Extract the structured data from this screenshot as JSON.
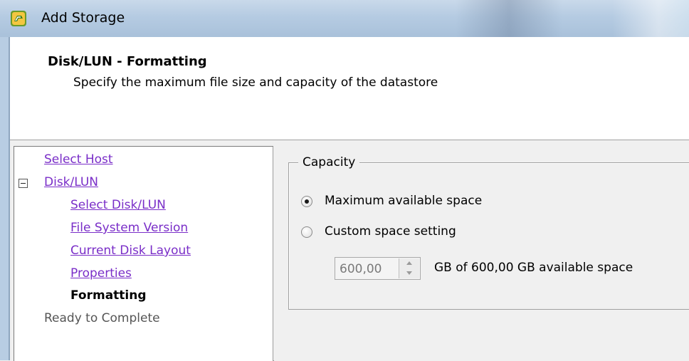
{
  "window": {
    "title": "Add Storage",
    "icon": "vsphere-storage-icon"
  },
  "header": {
    "title": "Disk/LUN - Formatting",
    "subtitle": "Specify the maximum file size and capacity of the datastore"
  },
  "nav": {
    "items": [
      {
        "label": "Select Host",
        "state": "link"
      },
      {
        "label": "Disk/LUN",
        "state": "link",
        "expanded": true
      },
      {
        "label": "Select Disk/LUN",
        "state": "link"
      },
      {
        "label": "File System Version",
        "state": "link"
      },
      {
        "label": "Current Disk Layout",
        "state": "link"
      },
      {
        "label": "Properties",
        "state": "link"
      },
      {
        "label": "Formatting",
        "state": "current"
      },
      {
        "label": "Ready to Complete",
        "state": "future"
      }
    ]
  },
  "capacity": {
    "legend": "Capacity",
    "options": [
      {
        "label": "Maximum available space",
        "checked": true
      },
      {
        "label": "Custom space setting",
        "checked": false
      }
    ],
    "spinner_value": "600,00",
    "available_text": "GB of 600,00 GB available space"
  },
  "colors": {
    "link": "#7a2ec8",
    "titlebar": "#b5cbe2",
    "panel_bg": "#f0f0f0"
  }
}
